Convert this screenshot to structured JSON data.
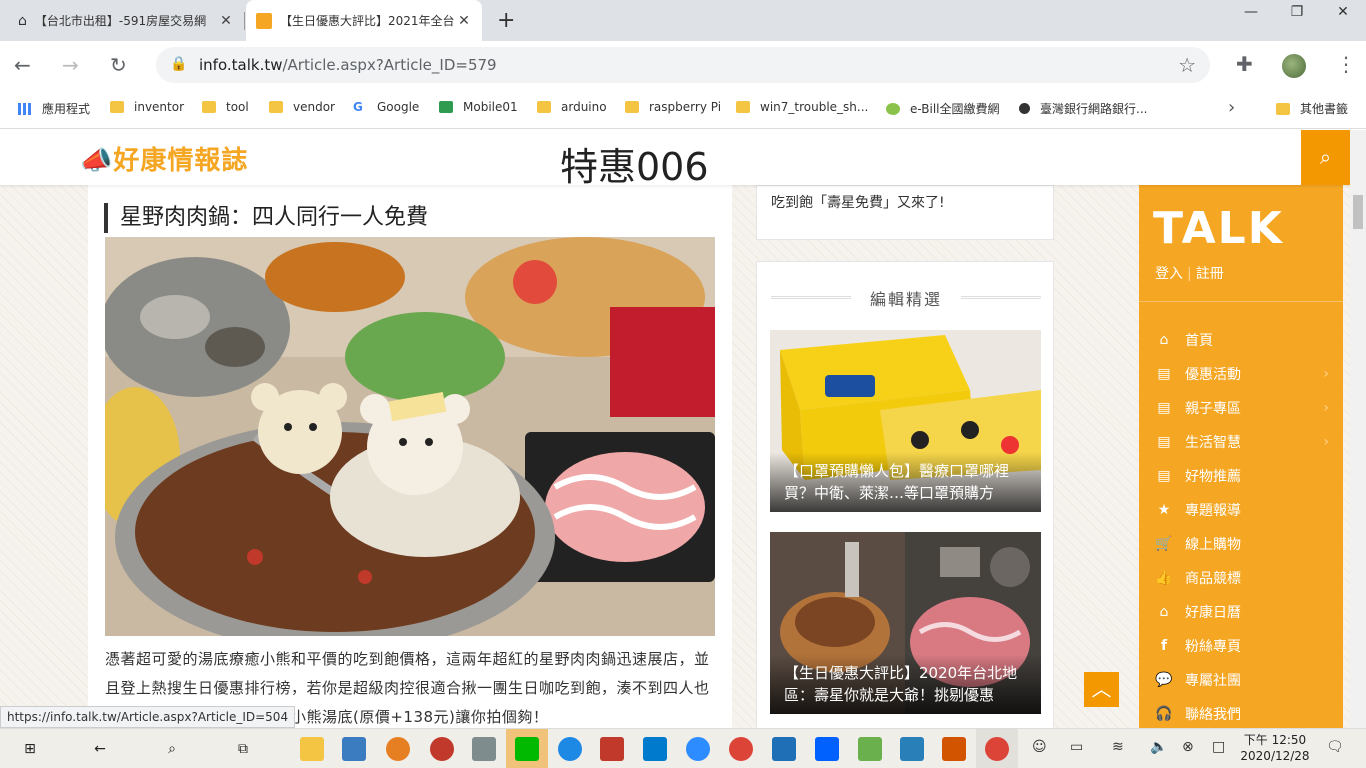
{
  "browser": {
    "tabs": [
      {
        "title": "【台北市出租】-591房屋交易網"
      },
      {
        "title": "【生日優惠大評比】2021年全台"
      }
    ],
    "new_tab": "+",
    "url_host": "info.talk.tw",
    "url_path": "/Article.aspx?Article_ID=579",
    "bookmarks": [
      "應用程式",
      "inventor",
      "tool",
      "vendor",
      "Google",
      "Mobile01",
      "arduino",
      "raspberry Pi",
      "win7_trouble_sh...",
      "e-Bill全國繳費網",
      "臺灣銀行網路銀行...",
      "其他書籤"
    ],
    "status_url": "https://info.talk.tw/Article.aspx?Article_ID=504"
  },
  "site": {
    "logo": "好康情報誌",
    "title": "特惠006",
    "article": {
      "heading": "星野肉肉鍋：四人同行一人免費",
      "text": "憑著超可愛的湯底療癒小熊和平價的吃到飽價格，這兩年超紅的星野肉肉鍋迅速展店，並且登上熱搜生日優惠排行榜，若你是超級肉控很適合揪一團生日咖吃到飽，湊不到四人也不用擔心，店家幫壽星加碼小熊湯底(原價+138元)讓你拍個夠！"
    },
    "sidebar": {
      "snippet": "吃到飽「壽星免費」又來了!",
      "heading": "編輯精選",
      "features": [
        {
          "caption": "【口罩預購懶人包】醫療口罩哪裡買？中衛、萊潔…等口罩預購方"
        },
        {
          "caption": "【生日優惠大評比】2020年台北地區：壽星你就是大爺！挑剔優惠"
        }
      ]
    },
    "talk": {
      "logo": "TALK",
      "login": "登入",
      "register": "註冊",
      "menu": [
        {
          "label": "首頁",
          "icon": "home-icon"
        },
        {
          "label": "優惠活動",
          "icon": "document-icon"
        },
        {
          "label": "親子專區",
          "icon": "document-icon"
        },
        {
          "label": "生活智慧",
          "icon": "document-icon"
        },
        {
          "label": "好物推薦",
          "icon": "document-icon"
        },
        {
          "label": "專題報導",
          "icon": "star-icon"
        },
        {
          "label": "線上購物",
          "icon": "cart-icon"
        },
        {
          "label": "商品競標",
          "icon": "thumbs-up-icon"
        },
        {
          "label": "好康日曆",
          "icon": "home-icon"
        },
        {
          "label": "粉絲專頁",
          "icon": "facebook-icon"
        },
        {
          "label": "專屬社團",
          "icon": "chat-icon"
        },
        {
          "label": "聯絡我們",
          "icon": "headset-icon"
        }
      ]
    }
  },
  "taskbar": {
    "time": "下午 12:50",
    "date": "2020/12/28"
  },
  "colors": {
    "accent": "#f5a623",
    "accent_dark": "#f39800"
  }
}
